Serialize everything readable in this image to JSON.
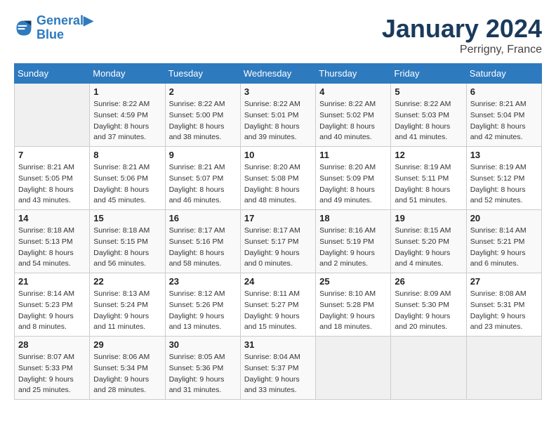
{
  "header": {
    "logo_line1": "General",
    "logo_line2": "Blue",
    "month": "January 2024",
    "location": "Perrigny, France"
  },
  "weekdays": [
    "Sunday",
    "Monday",
    "Tuesday",
    "Wednesday",
    "Thursday",
    "Friday",
    "Saturday"
  ],
  "weeks": [
    [
      {
        "day": "",
        "info": ""
      },
      {
        "day": "1",
        "info": "Sunrise: 8:22 AM\nSunset: 4:59 PM\nDaylight: 8 hours\nand 37 minutes."
      },
      {
        "day": "2",
        "info": "Sunrise: 8:22 AM\nSunset: 5:00 PM\nDaylight: 8 hours\nand 38 minutes."
      },
      {
        "day": "3",
        "info": "Sunrise: 8:22 AM\nSunset: 5:01 PM\nDaylight: 8 hours\nand 39 minutes."
      },
      {
        "day": "4",
        "info": "Sunrise: 8:22 AM\nSunset: 5:02 PM\nDaylight: 8 hours\nand 40 minutes."
      },
      {
        "day": "5",
        "info": "Sunrise: 8:22 AM\nSunset: 5:03 PM\nDaylight: 8 hours\nand 41 minutes."
      },
      {
        "day": "6",
        "info": "Sunrise: 8:21 AM\nSunset: 5:04 PM\nDaylight: 8 hours\nand 42 minutes."
      }
    ],
    [
      {
        "day": "7",
        "info": "Sunrise: 8:21 AM\nSunset: 5:05 PM\nDaylight: 8 hours\nand 43 minutes."
      },
      {
        "day": "8",
        "info": "Sunrise: 8:21 AM\nSunset: 5:06 PM\nDaylight: 8 hours\nand 45 minutes."
      },
      {
        "day": "9",
        "info": "Sunrise: 8:21 AM\nSunset: 5:07 PM\nDaylight: 8 hours\nand 46 minutes."
      },
      {
        "day": "10",
        "info": "Sunrise: 8:20 AM\nSunset: 5:08 PM\nDaylight: 8 hours\nand 48 minutes."
      },
      {
        "day": "11",
        "info": "Sunrise: 8:20 AM\nSunset: 5:09 PM\nDaylight: 8 hours\nand 49 minutes."
      },
      {
        "day": "12",
        "info": "Sunrise: 8:19 AM\nSunset: 5:11 PM\nDaylight: 8 hours\nand 51 minutes."
      },
      {
        "day": "13",
        "info": "Sunrise: 8:19 AM\nSunset: 5:12 PM\nDaylight: 8 hours\nand 52 minutes."
      }
    ],
    [
      {
        "day": "14",
        "info": "Sunrise: 8:18 AM\nSunset: 5:13 PM\nDaylight: 8 hours\nand 54 minutes."
      },
      {
        "day": "15",
        "info": "Sunrise: 8:18 AM\nSunset: 5:15 PM\nDaylight: 8 hours\nand 56 minutes."
      },
      {
        "day": "16",
        "info": "Sunrise: 8:17 AM\nSunset: 5:16 PM\nDaylight: 8 hours\nand 58 minutes."
      },
      {
        "day": "17",
        "info": "Sunrise: 8:17 AM\nSunset: 5:17 PM\nDaylight: 9 hours\nand 0 minutes."
      },
      {
        "day": "18",
        "info": "Sunrise: 8:16 AM\nSunset: 5:19 PM\nDaylight: 9 hours\nand 2 minutes."
      },
      {
        "day": "19",
        "info": "Sunrise: 8:15 AM\nSunset: 5:20 PM\nDaylight: 9 hours\nand 4 minutes."
      },
      {
        "day": "20",
        "info": "Sunrise: 8:14 AM\nSunset: 5:21 PM\nDaylight: 9 hours\nand 6 minutes."
      }
    ],
    [
      {
        "day": "21",
        "info": "Sunrise: 8:14 AM\nSunset: 5:23 PM\nDaylight: 9 hours\nand 8 minutes."
      },
      {
        "day": "22",
        "info": "Sunrise: 8:13 AM\nSunset: 5:24 PM\nDaylight: 9 hours\nand 11 minutes."
      },
      {
        "day": "23",
        "info": "Sunrise: 8:12 AM\nSunset: 5:26 PM\nDaylight: 9 hours\nand 13 minutes."
      },
      {
        "day": "24",
        "info": "Sunrise: 8:11 AM\nSunset: 5:27 PM\nDaylight: 9 hours\nand 15 minutes."
      },
      {
        "day": "25",
        "info": "Sunrise: 8:10 AM\nSunset: 5:28 PM\nDaylight: 9 hours\nand 18 minutes."
      },
      {
        "day": "26",
        "info": "Sunrise: 8:09 AM\nSunset: 5:30 PM\nDaylight: 9 hours\nand 20 minutes."
      },
      {
        "day": "27",
        "info": "Sunrise: 8:08 AM\nSunset: 5:31 PM\nDaylight: 9 hours\nand 23 minutes."
      }
    ],
    [
      {
        "day": "28",
        "info": "Sunrise: 8:07 AM\nSunset: 5:33 PM\nDaylight: 9 hours\nand 25 minutes."
      },
      {
        "day": "29",
        "info": "Sunrise: 8:06 AM\nSunset: 5:34 PM\nDaylight: 9 hours\nand 28 minutes."
      },
      {
        "day": "30",
        "info": "Sunrise: 8:05 AM\nSunset: 5:36 PM\nDaylight: 9 hours\nand 31 minutes."
      },
      {
        "day": "31",
        "info": "Sunrise: 8:04 AM\nSunset: 5:37 PM\nDaylight: 9 hours\nand 33 minutes."
      },
      {
        "day": "",
        "info": ""
      },
      {
        "day": "",
        "info": ""
      },
      {
        "day": "",
        "info": ""
      }
    ]
  ]
}
